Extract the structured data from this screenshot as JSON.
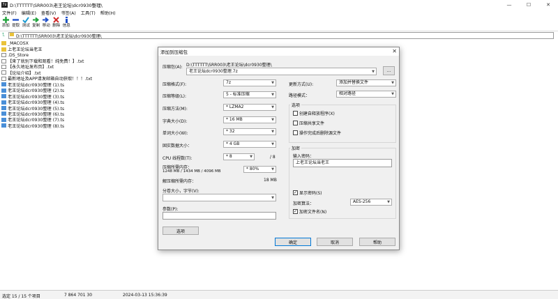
{
  "window": {
    "title": "D:\\TTTTTT\\SRR003\\老王论坛\\dcr0930整理\\",
    "app_icon": "7z",
    "minimize": "—",
    "maximize": "☐",
    "close": "✕"
  },
  "menu": [
    "文件(F)",
    "编辑(E)",
    "查看(V)",
    "书签(A)",
    "工具(T)",
    "帮助(H)"
  ],
  "toolbar": [
    {
      "label": "添加",
      "icon": "plus-icon"
    },
    {
      "label": "提取",
      "icon": "minus-icon"
    },
    {
      "label": "测试",
      "icon": "check-icon"
    },
    {
      "label": "复制",
      "icon": "copy-arrow-icon"
    },
    {
      "label": "移动",
      "icon": "move-arrow-icon"
    },
    {
      "label": "删除",
      "icon": "delete-x-icon"
    },
    {
      "label": "信息",
      "icon": "info-icon"
    }
  ],
  "address": "D:\\TTTTTT\\SRR003\\老王论坛\\dcr0930整理\\",
  "files": [
    {
      "name": "_MACOSX",
      "type": "folder"
    },
    {
      "name": "上老王论坛当老王",
      "type": "folder"
    },
    {
      "name": ".DS_Store",
      "type": "file"
    },
    {
      "name": "【来了就别下载和观看！纯免费！】.txt",
      "type": "file"
    },
    {
      "name": "【永久地址发布页】.txt",
      "type": "file"
    },
    {
      "name": "【论坛介绍】.txt",
      "type": "file"
    },
    {
      "name": "最新地址及APP请发邮箱自动获取！！！.txt",
      "type": "file"
    },
    {
      "name": "老王论坛dcr0930整理 (1).ts",
      "type": "ts"
    },
    {
      "name": "老王论坛dcr0930整理 (2).ts",
      "type": "ts"
    },
    {
      "name": "老王论坛dcr0930整理 (3).ts",
      "type": "ts"
    },
    {
      "name": "老王论坛dcr0930整理 (4).ts",
      "type": "ts"
    },
    {
      "name": "老王论坛dcr0930整理 (5).ts",
      "type": "ts"
    },
    {
      "name": "老王论坛dcr0930整理 (6).ts",
      "type": "ts"
    },
    {
      "name": "老王论坛dcr0930整理 (7).ts",
      "type": "ts"
    },
    {
      "name": "老王论坛dcr0930整理 (8).ts",
      "type": "ts"
    }
  ],
  "status": {
    "selection": "选定 15 / 15 个项目",
    "size": "7 864 701 30",
    "date": "2024-03-13 15:36:39"
  },
  "dialog": {
    "title": "添加到压缩包",
    "close": "✕",
    "archive_label": "压缩包(A):",
    "archive_path": "D:\\TTTTTT\\SRR003\\老王论坛\\dcr0930整理\\",
    "archive_name": "老王论坛dcr0930整理.7z",
    "browse": "...",
    "format_label": "压缩格式(F):",
    "format_value": "7z",
    "level_label": "压缩等级(L):",
    "level_value": "5 - 标准压缩",
    "method_label": "压缩方法(M):",
    "method_value": "* LZMA2",
    "dict_label": "字典大小(D):",
    "dict_value": "* 16 MB",
    "word_label": "单词大小(W):",
    "word_value": "* 32",
    "solid_label": "固实数据大小：",
    "solid_value": "* 4 GB",
    "cpu_label": "CPU 线程数(T):",
    "cpu_value": "* 8",
    "cpu_total": "/ 8",
    "mem_label": "压缩所需内存：",
    "mem_detail": "1248 MB / 1434 MB / 4096 MB",
    "mem_value": "* 80%",
    "decomp_label": "解压缩所需内存：",
    "decomp_value": "18 MB",
    "split_label": "分卷大小，字节(V):",
    "params_label": "参数(P):",
    "options_button": "选项",
    "update_label": "更新方式(U):",
    "update_value": "添加并替换文件",
    "path_label": "路径模式：",
    "path_value": "相对路径",
    "options_group": "选项",
    "opt_sfx": "创建自释放程序(X)",
    "opt_shared": "压缩共享文件",
    "opt_delete": "操作完成后删除源文件",
    "encrypt_group": "加密",
    "pwd_label": "输入密码：",
    "pwd_value": "上老王论坛当老王",
    "show_pwd": "显示密码(S)",
    "enc_method_label": "加密算法：",
    "enc_method_value": "AES-256",
    "enc_names": "加密文件名(N)",
    "ok": "确定",
    "cancel": "取消",
    "help": "帮助"
  }
}
